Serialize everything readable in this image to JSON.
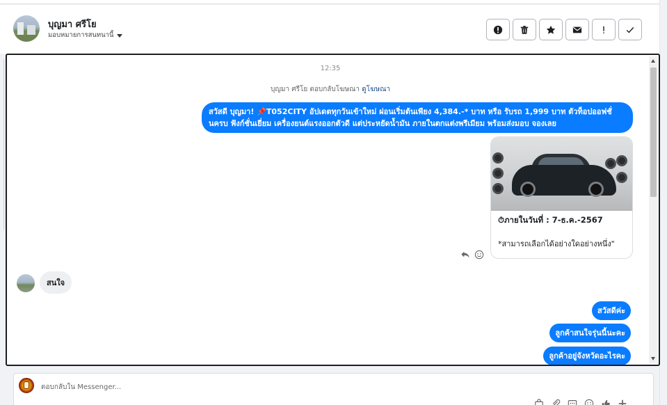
{
  "header": {
    "contact_name": "บุญมา ศรีโย",
    "assign_label": "มอบหมายการสนทนานี้"
  },
  "actions": [
    {
      "name": "spam-button",
      "icon": "alert-circle-icon"
    },
    {
      "name": "delete-button",
      "icon": "trash-icon"
    },
    {
      "name": "star-button",
      "icon": "star-icon"
    },
    {
      "name": "unread-button",
      "icon": "envelope-icon"
    },
    {
      "name": "follow-up-button",
      "icon": "exclamation-icon"
    },
    {
      "name": "done-button",
      "icon": "check-icon"
    }
  ],
  "chat": {
    "time": "12:35",
    "reply_note_prefix": "บุญมา ศรีโย ตอบกลับโฆษณา",
    "reply_note_link": "ดูโฆษณา",
    "ad_message": "สวัสดี บุญมา! 📌T052CITY  อัปเดตทุกวันเข้าใหม่ ผ่อนเริ่มต้นเพียง 4,384.-* บาท หรือ รับรถ 1,999 บาท ตัวท็อปออฟชั่นครบ ฟังก์ชั่นเยี่ยม เครื่องยนต์แรงออกตัวดี แต่ประหยัดน้ำมัน ภายในตกแต่งพรีเมียม พร้อมส่งมอบ จองเลย",
    "card_title": "⏱ภายในวันที่ : 7-ธ.ค.-2567",
    "card_subtitle": "*สามารถเลือกได้อย่างใดอย่างหนึ่ง\"",
    "customer_reply": "สนใจ",
    "agent_replies": [
      "สวัสดีค่ะ",
      "ลูกค้าสนใจรุ่นนี้นะคะ",
      "ลูกค้าอยู่จังหวัดอะไรคะ"
    ]
  },
  "composer": {
    "placeholder": "ตอบกลับใน Messenger..."
  },
  "colors": {
    "accent_blue": "#0a7cff",
    "gray_bubble": "#eeeff1",
    "link": "#1f4e8c"
  }
}
